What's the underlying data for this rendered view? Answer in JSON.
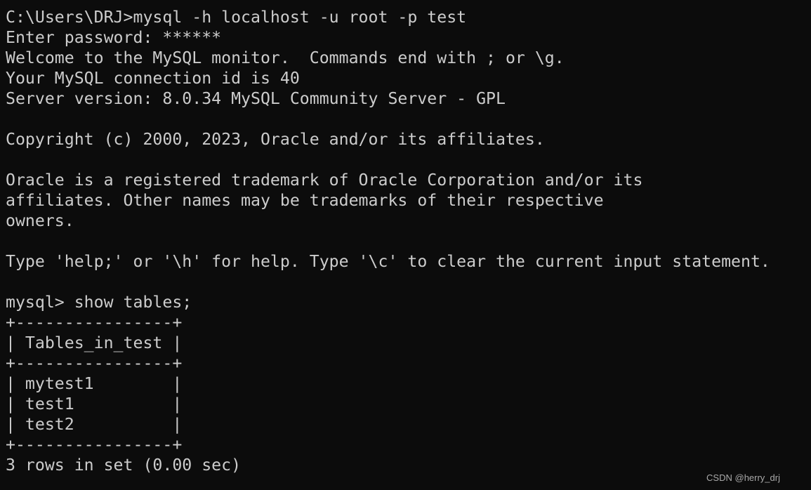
{
  "terminal": {
    "lines": [
      "C:\\Users\\DRJ>mysql -h localhost -u root -p test",
      "Enter password: ******",
      "Welcome to the MySQL monitor.  Commands end with ; or \\g.",
      "Your MySQL connection id is 40",
      "Server version: 8.0.34 MySQL Community Server - GPL",
      "",
      "Copyright (c) 2000, 2023, Oracle and/or its affiliates.",
      "",
      "Oracle is a registered trademark of Oracle Corporation and/or its",
      "affiliates. Other names may be trademarks of their respective",
      "owners.",
      "",
      "Type 'help;' or '\\h' for help. Type '\\c' to clear the current input statement.",
      "",
      "mysql> show tables;",
      "+----------------+",
      "| Tables_in_test |",
      "+----------------+",
      "| mytest1        |",
      "| test1          |",
      "| test2          |",
      "+----------------+",
      "3 rows in set (0.00 sec)"
    ],
    "background": "#0c0c0c",
    "foreground": "#cccccc"
  },
  "watermark": "CSDN @herry_drj"
}
